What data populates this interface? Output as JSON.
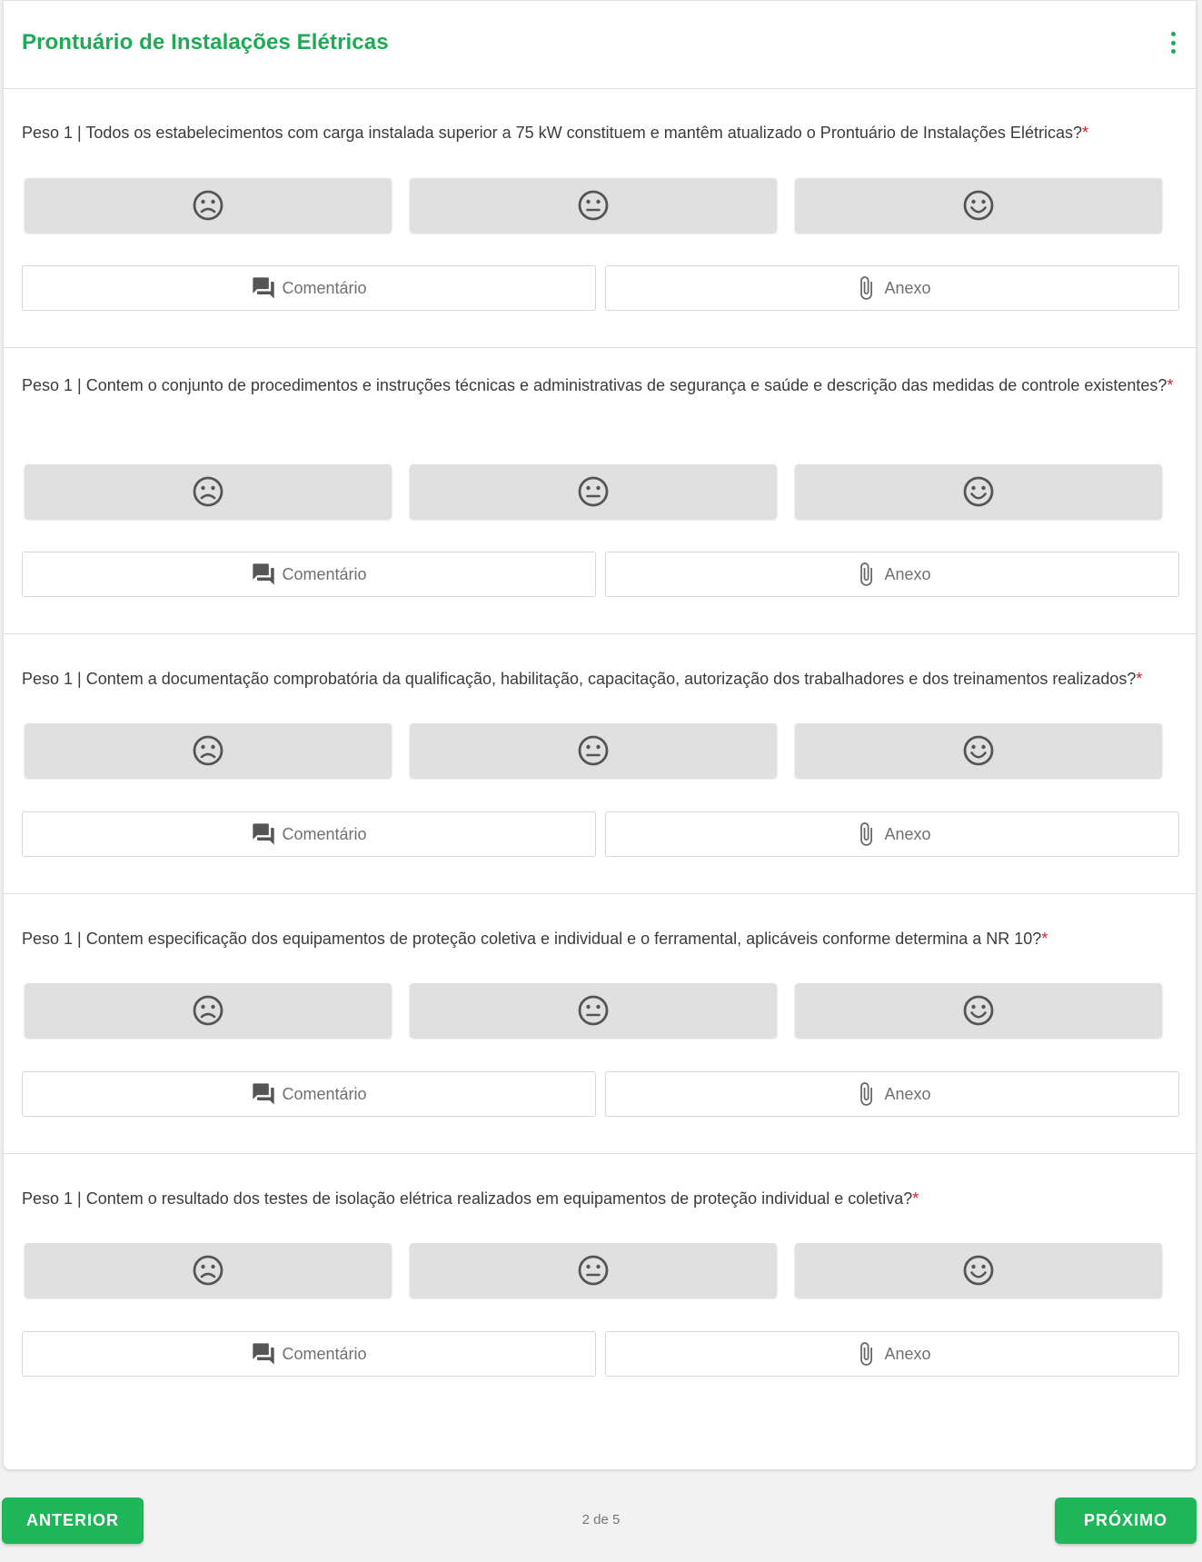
{
  "header": {
    "title": "Prontuário de Instalações Elétricas",
    "menu_icon": "more-vert-icon"
  },
  "colors": {
    "accent": "#1faa55",
    "required": "#d0202a",
    "rating_bg": "#e0e0e0"
  },
  "rating_icons": [
    "sad-face-icon",
    "neutral-face-icon",
    "happy-face-icon"
  ],
  "actions": {
    "comment_label": "Comentário",
    "comment_icon": "comment-icon",
    "attach_label": "Anexo",
    "attach_icon": "paperclip-icon"
  },
  "questions": [
    {
      "text": "Peso 1 | Todos os estabelecimentos com carga instalada superior a 75 kW constituem e mantêm atualizado o Prontuário de Instalações Elétricas?",
      "required_mark": "*"
    },
    {
      "text": "Peso 1 | Contem o conjunto de procedimentos e instruções técnicas e administrativas de segurança e saúde e descrição das medidas de controle existentes?",
      "required_mark": "*"
    },
    {
      "text": "Peso 1 | Contem a documentação comprobatória da qualificação, habilitação, capacitação, autorização dos trabalhadores e dos treinamentos realizados?",
      "required_mark": "*"
    },
    {
      "text": "Peso 1 | Contem especificação dos equipamentos de proteção coletiva e individual e o ferramental, aplicáveis conforme determina a NR 10?",
      "required_mark": "*"
    },
    {
      "text": "Peso 1 | Contem o resultado dos testes de isolação elétrica realizados em equipamentos de proteção individual e coletiva?",
      "required_mark": "*"
    }
  ],
  "footer": {
    "prev_label": "ANTERIOR",
    "next_label": "PRÓXIMO",
    "page_indicator": "2 de 5"
  }
}
